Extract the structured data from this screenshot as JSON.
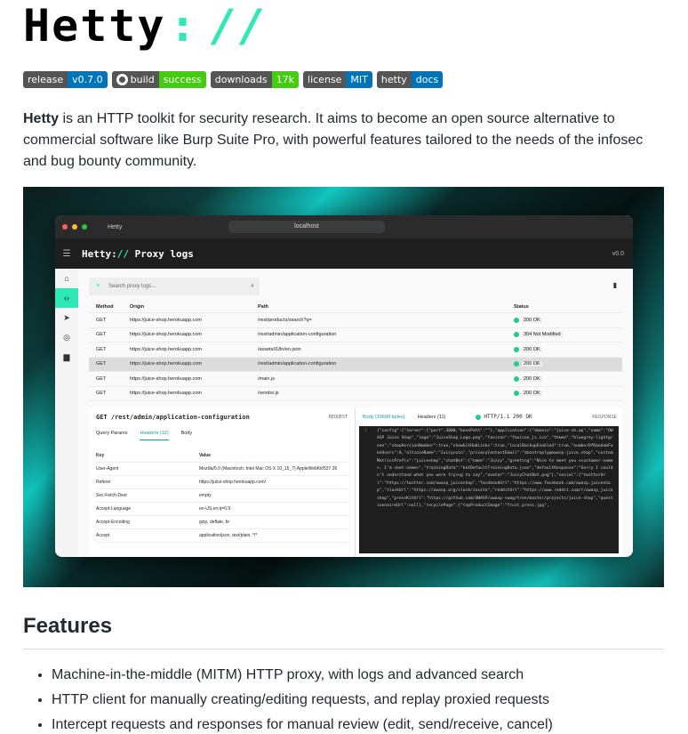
{
  "logo": {
    "name": "Hetty",
    "colon": ":",
    "slashes": "//"
  },
  "badges": [
    {
      "label": "release",
      "value": "v0.7.0",
      "color": "#0074b8"
    },
    {
      "label": "build",
      "value": "success",
      "color": "#4c1",
      "icon": "github-icon"
    },
    {
      "label": "downloads",
      "value": "17k",
      "color": "#4c1"
    },
    {
      "label": "license",
      "value": "MIT",
      "color": "#0074b8"
    },
    {
      "label": "hetty",
      "value": "docs",
      "color": "#0074b8"
    }
  ],
  "intro": {
    "strong": "Hetty",
    "text": " is an HTTP toolkit for security research. It aims to become an open source alternative to commercial software like Burp Suite Pro, with powerful features tailored to the needs of the infosec and bug bounty community."
  },
  "screenshot": {
    "tab": "Hetty",
    "url": "localhost",
    "app_title_main": "Hetty:",
    "app_title_slashes": "//",
    "app_title_rest": " Proxy logs",
    "version": "v0.0",
    "search_placeholder": "Search proxy logs…",
    "columns": [
      "Method",
      "Origin",
      "Path",
      "Status"
    ],
    "rows": [
      {
        "method": "GET",
        "origin": "https://juice-shop.herokuapp.com",
        "path": "/rest/products/search?q=",
        "status": "200 OK"
      },
      {
        "method": "GET",
        "origin": "https://juice-shop.herokuapp.com",
        "path": "/rest/admin/application-configuration",
        "status": "304 Not Modified"
      },
      {
        "method": "GET",
        "origin": "https://juice-shop.herokuapp.com",
        "path": "/assets/i18n/en.json",
        "status": "200 OK"
      },
      {
        "method": "GET",
        "origin": "https://juice-shop.herokuapp.com",
        "path": "/rest/admin/application-configuration",
        "status": "200 OK"
      },
      {
        "method": "GET",
        "origin": "https://juice-shop.herokuapp.com",
        "path": "/main.js",
        "status": "200 OK"
      },
      {
        "method": "GET",
        "origin": "https://juice-shop.herokuapp.com",
        "path": "/vendor.js",
        "status": "200 OK"
      }
    ],
    "request": {
      "title": "GET /rest/admin/application-configuration",
      "tag": "REQUEST",
      "tabs": [
        "Query Params",
        "Headers (12)",
        "Body"
      ],
      "header_cols": [
        "Key",
        "Value"
      ],
      "headers": [
        {
          "k": "User-Agent",
          "v": "Mozilla/5.0 (Macintosh; Intel Mac OS X 10_15_7) AppleWebKit/537.36"
        },
        {
          "k": "Referer",
          "v": "https://juice-shop.herokuapp.com/"
        },
        {
          "k": "Sec-Fetch-Dest",
          "v": "empty"
        },
        {
          "k": "Accept-Language",
          "v": "en-US,en;q=0.9"
        },
        {
          "k": "Accept-Encoding",
          "v": "gzip, deflate, br"
        },
        {
          "k": "Accept",
          "v": "application/json, text/plain, */*"
        }
      ]
    },
    "response": {
      "tabs": [
        "Body (10690 bytes)",
        "Headers (11)"
      ],
      "status": "HTTP/1.1 200 OK",
      "tag": "RESPONSE",
      "line_no": "1",
      "code": "{\"config\":{\"server\":{\"port\":3000,\"basePath\":\"\"},\"application\":{\"domain\":\"juice-sh.op\",\"name\":\"OWASP Juice Shop\",\"logo\":\"JuiceShop_Logo.png\",\"favicon\":\"favicon_js.ico\",\"theme\":\"bluegrey-lightgreen\",\"showVersionNumber\":true,\"showGitHubLinks\":true,\"localBackupEnabled\":true,\"numberOfRandomFakeUsers\":0,\"altcoinName\":\"Juicycoin\",\"privacyContactEmail\":\"donotreply@owasp-juice.shop\",\"customMetricsPrefix\":\"juiceshop\",\"chatBot\":{\"name\":\"Juicy\",\"greeting\":\"Nice to meet you <customer-name>, I'm <bot-name>\",\"trainingData\":\"botDefaultTrainingData.json\",\"defaultResponse\":\"Sorry I couldn't understand what you were trying to say\",\"avatar\":\"JuicyChatBot.png\"},\"social\":{\"twitterUrl\":\"https://twitter.com/owasp_juiceshop\",\"facebookUrl\":\"https://www.facebook.com/owasp.juiceshop\",\"slackUrl\":\"https://owasp.org/slack/invite\",\"redditUrl\":\"https://www.reddit.com/r/owasp_juiceshop\",\"pressKitUrl\":\"https://github.com/OWASP/owasp-swag/tree/master/projects/juice-shop\",\"questionnaireUrl\":null},\"recyclePage\":{\"topProductImage\":\"fruit_press.jpg\","
    }
  },
  "features": {
    "heading": "Features",
    "items": [
      "Machine-in-the-middle (MITM) HTTP proxy, with logs and advanced search",
      "HTTP client for manually creating/editing requests, and replay proxied requests",
      "Intercept requests and responses for manual review (edit, send/receive, cancel)"
    ]
  }
}
